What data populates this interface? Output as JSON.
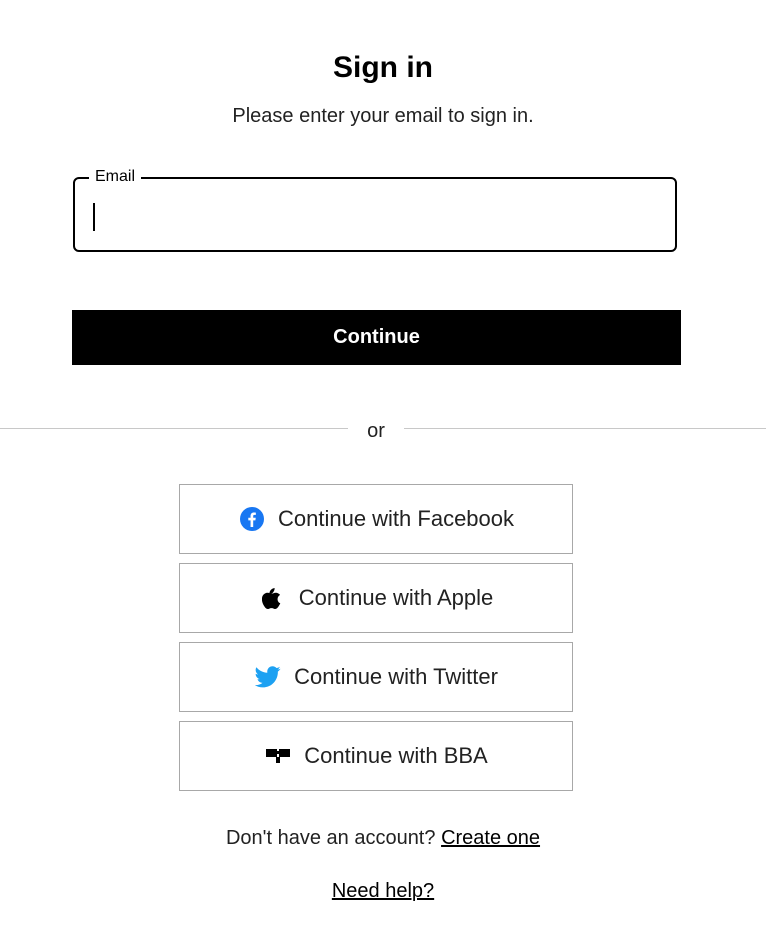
{
  "header": {
    "title": "Sign in",
    "subtitle": "Please enter your email to sign in."
  },
  "email_field": {
    "label": "Email",
    "value": "",
    "placeholder": ""
  },
  "continue_button": {
    "label": "Continue"
  },
  "divider": {
    "text": "or"
  },
  "social_buttons": [
    {
      "label": "Continue with Facebook",
      "icon": "facebook-icon",
      "icon_color": "#1877F2"
    },
    {
      "label": "Continue with Apple",
      "icon": "apple-icon",
      "icon_color": "#000000"
    },
    {
      "label": "Continue with Twitter",
      "icon": "twitter-icon",
      "icon_color": "#1DA1F2"
    },
    {
      "label": "Continue with BBA",
      "icon": "bba-icon",
      "icon_color": "#000000"
    }
  ],
  "footer": {
    "no_account_text": "Don't have an account?",
    "create_link": "Create one",
    "help_link": "Need help?"
  }
}
